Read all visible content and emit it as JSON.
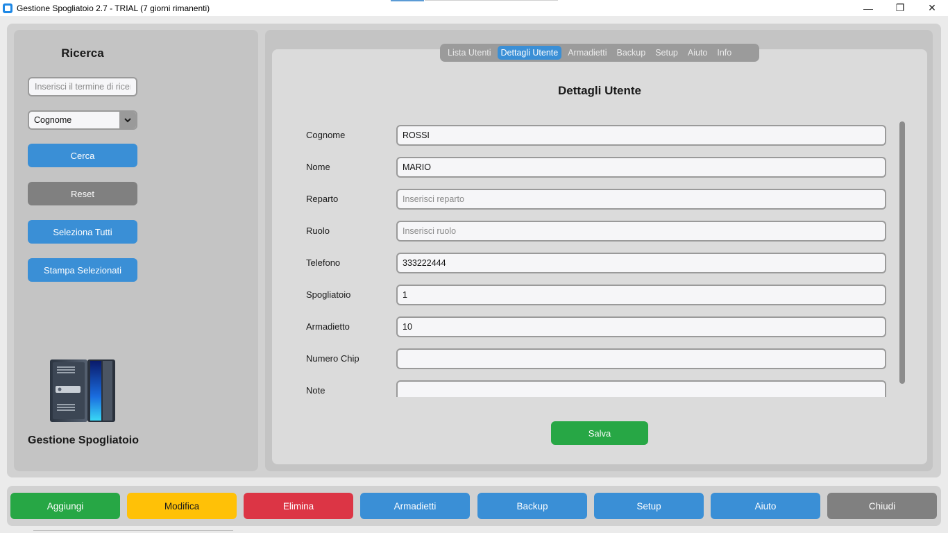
{
  "window": {
    "title": "Gestione Spogliatoio 2.7 - TRIAL (7 giorni rimanenti)",
    "controls": {
      "minimize": "—",
      "maximize": "❐",
      "close": "✕"
    }
  },
  "sidebar": {
    "title": "Ricerca",
    "search": {
      "placeholder": "Inserisci il termine di ricerca",
      "value": ""
    },
    "field_select": {
      "value": "Cognome"
    },
    "buttons": {
      "search": "Cerca",
      "reset": "Reset",
      "select_all": "Seleziona Tutti",
      "print_selected": "Stampa Selezionati"
    },
    "logo_caption": "Gestione Spogliatoio"
  },
  "tabs": [
    "Lista Utenti",
    "Dettagli Utente",
    "Armadietti",
    "Backup",
    "Setup",
    "Aiuto",
    "Info"
  ],
  "active_tab": "Dettagli Utente",
  "details": {
    "title": "Dettagli Utente",
    "fields": [
      {
        "label": "Cognome",
        "value": "ROSSI",
        "placeholder": ""
      },
      {
        "label": "Nome",
        "value": "MARIO",
        "placeholder": ""
      },
      {
        "label": "Reparto",
        "value": "",
        "placeholder": "Inserisci reparto"
      },
      {
        "label": "Ruolo",
        "value": "",
        "placeholder": "Inserisci ruolo"
      },
      {
        "label": "Telefono",
        "value": "333222444",
        "placeholder": ""
      },
      {
        "label": "Spogliatoio",
        "value": "1",
        "placeholder": ""
      },
      {
        "label": "Armadietto",
        "value": "10",
        "placeholder": ""
      },
      {
        "label": "Numero Chip",
        "value": "",
        "placeholder": ""
      },
      {
        "label": "Note",
        "value": "",
        "placeholder": ""
      }
    ],
    "save": "Salva"
  },
  "bottom_buttons": {
    "add": "Aggiungi",
    "edit": "Modifica",
    "delete": "Elimina",
    "lockers": "Armadietti",
    "backup": "Backup",
    "setup": "Setup",
    "help": "Aiuto",
    "close": "Chiudi"
  },
  "colors": {
    "primary_blue": "#3a8fd6",
    "green": "#27a745",
    "yellow": "#ffc107",
    "red": "#dc3545",
    "gray": "#808080"
  }
}
